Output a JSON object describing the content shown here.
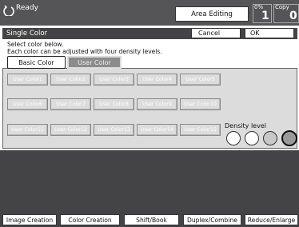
{
  "status": {
    "text": "Ready",
    "icon": "power-cycle-icon"
  },
  "header": {
    "area_editing": "Area Editing",
    "percent_label": "0%",
    "percent_value": "1",
    "copy_label": "Copy",
    "copy_value": "0"
  },
  "dialog": {
    "title": "Single Color",
    "cancel": "Cancel",
    "ok": "OK",
    "instruction_1": "Select color below.",
    "instruction_2": "Each color can be adjusted with four density levels."
  },
  "tabs": {
    "basic": "Basic Color",
    "user": "User Color"
  },
  "user_colors": [
    "User Color1",
    "User Color2",
    "User Color3",
    "User Color4",
    "User Color5",
    "User Color6",
    "User Color7",
    "User Color8",
    "User Color9",
    "User Color10",
    "User Color11",
    "User Color12",
    "User Color13",
    "User Color14",
    "User Color15"
  ],
  "density": {
    "label": "Density level"
  },
  "bottom_tabs": [
    "Image Creation",
    "Color Creation",
    "Shift/Book",
    "Duplex/Combine",
    "Reduce/Enlarge"
  ]
}
